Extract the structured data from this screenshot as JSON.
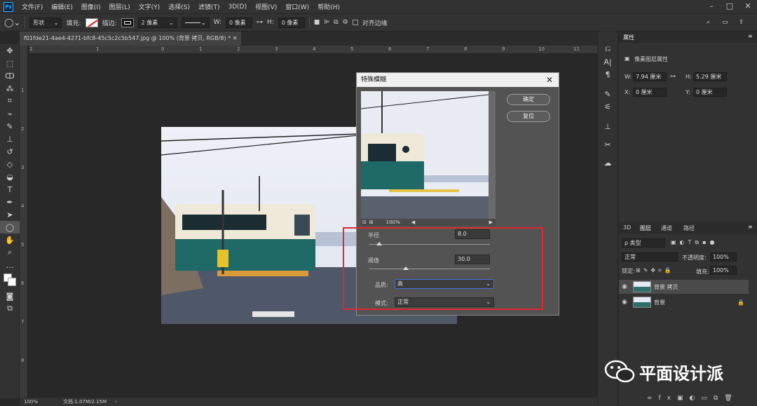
{
  "app": {
    "logo": "Ps"
  },
  "menu": [
    "文件(F)",
    "编辑(E)",
    "图像(I)",
    "图层(L)",
    "文字(Y)",
    "选择(S)",
    "滤镜(T)",
    "3D(D)",
    "视图(V)",
    "窗口(W)",
    "帮助(H)"
  ],
  "options": {
    "mode": "形状",
    "fill_label": "填充:",
    "stroke_label": "描边:",
    "stroke_width": "2 像素",
    "w_label": "W:",
    "w_value": "0 像素",
    "h_label": "H:",
    "h_value": "0 像素",
    "align_edges": "对齐边缘"
  },
  "document": {
    "tab_title": "f01fde21-4ae4-4271-bfc8-45c5c2c5b547.jpg @ 100% (背景 拷贝, RGB/8) *",
    "zoom": "100%",
    "doc_info": "文档:1.07M/2.15M"
  },
  "ruler": {
    "h_ticks": [
      "2",
      "1",
      "0",
      "1",
      "2",
      "3",
      "4",
      "5",
      "6",
      "7",
      "8",
      "9",
      "10",
      "11"
    ],
    "v_ticks": [
      "1",
      "2",
      "3",
      "4",
      "5",
      "6",
      "7",
      "8"
    ]
  },
  "dialog": {
    "title": "特殊模糊",
    "ok": "确定",
    "reset": "复位",
    "preview_zoom": "100%",
    "radius_label": "半径",
    "radius_value": "8.0",
    "radius_fraction": 0.08,
    "threshold_label": "阈值",
    "threshold_value": "30.0",
    "threshold_fraction": 0.3,
    "quality_label": "品质:",
    "quality_value": "高",
    "mode_label": "模式:",
    "mode_value": "正常"
  },
  "properties": {
    "tab": "属性",
    "title": "像素图层属性",
    "w_label": "W:",
    "w_value": "7.94 厘米",
    "h_label": "H:",
    "h_value": "5.29 厘米",
    "x_label": "X:",
    "x_value": "0 厘米",
    "y_label": "Y:",
    "y_value": "0 厘米"
  },
  "layers": {
    "tabs": [
      "3D",
      "图层",
      "通道",
      "路径"
    ],
    "filter": "ρ 类型",
    "blend": "正常",
    "opacity_label": "不透明度:",
    "opacity_value": "100%",
    "lock_label": "锁定:",
    "fill_label": "填充:",
    "fill_value": "100%",
    "items": [
      {
        "name": "背景 拷贝"
      },
      {
        "name": "背景"
      }
    ]
  },
  "watermark": {
    "text": "平面设计派"
  },
  "colors": {
    "accent": "#31a8ff",
    "highlight": "#e0282e"
  }
}
